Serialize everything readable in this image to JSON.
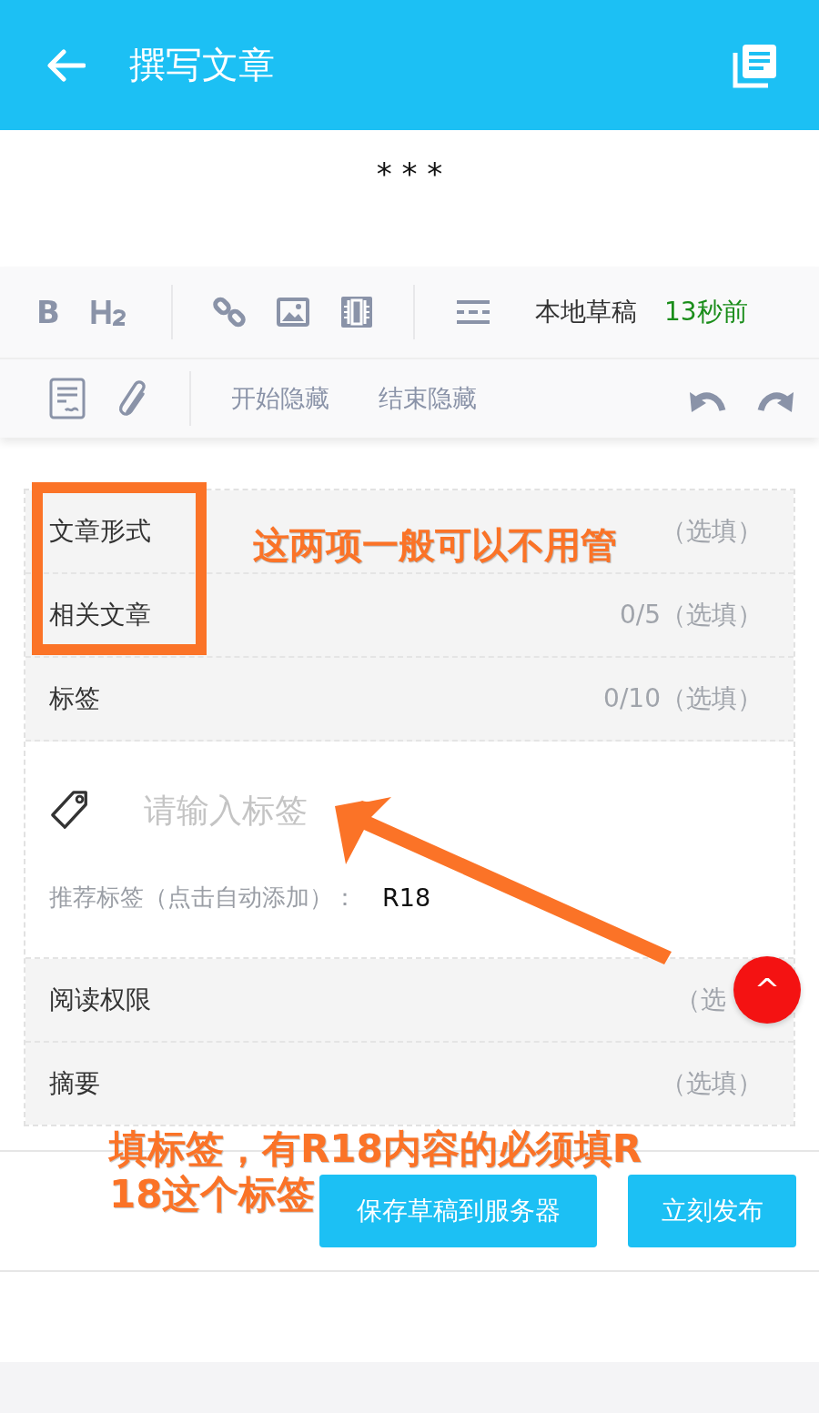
{
  "app_bar": {
    "title": "撰写文章"
  },
  "article_title": "* * *",
  "toolbar": {
    "bold_button": "B",
    "draft_label": "本地草稿",
    "draft_time": "13秒前",
    "hide_buttons": [
      "开始隐藏",
      "结束隐藏"
    ]
  },
  "form_rows": [
    {
      "label": "文章形式",
      "value": "（选填）"
    },
    {
      "label": "相关文章",
      "value": "0/5（选填）"
    },
    {
      "label": "标签",
      "value": "0/10（选填）"
    }
  ],
  "tag_input": {
    "placeholder": "请输入标签",
    "suggest_label": "推荐标签（点击自动添加）：",
    "suggested_tags": [
      "R18"
    ]
  },
  "more_rows": [
    {
      "label": "阅读权限",
      "value": "（选"
    },
    {
      "label": "摘要",
      "value": "（选填）"
    }
  ],
  "buttons": [
    "保存草稿到服务器",
    "立刻发布"
  ],
  "scroll_top_button": "^",
  "annotations": [
    {
      "kind": "box"
    },
    {
      "kind": "text",
      "text": "这两项一般可以不用管"
    },
    {
      "kind": "arrow"
    },
    {
      "kind": "text",
      "text": "填标签，有R18内容的必须填R"
    },
    {
      "kind": "text",
      "text": "18这个标签"
    }
  ]
}
